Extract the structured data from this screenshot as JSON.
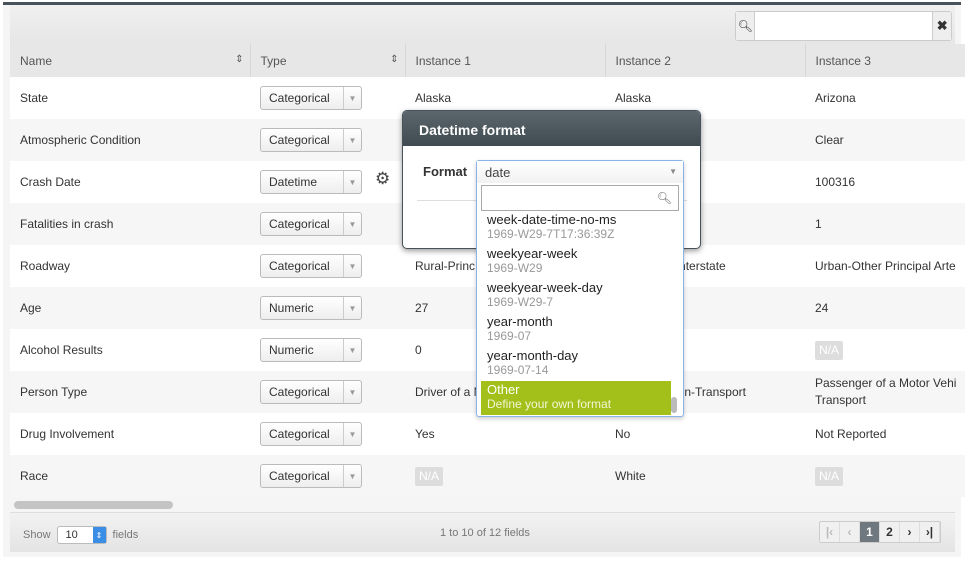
{
  "search": {
    "placeholder": "",
    "search_icon": "search-icon",
    "clear_icon": "x-icon"
  },
  "columns": [
    "Name",
    "Type",
    "Instance 1",
    "Instance 2",
    "Instance 3"
  ],
  "rows": [
    {
      "name": "State",
      "type": "Categorical",
      "i1": "Alaska",
      "i2": "Alaska",
      "i3": "Arizona"
    },
    {
      "name": "Atmospheric Condition",
      "type": "Categorical",
      "i1": "",
      "i2": "",
      "i3": "Clear"
    },
    {
      "name": "Crash Date",
      "type": "Datetime",
      "i1": "",
      "i2": "",
      "i3": "100316"
    },
    {
      "name": "Fatalities in crash",
      "type": "Categorical",
      "i1": "",
      "i2": "",
      "i3": "1"
    },
    {
      "name": "Roadway",
      "type": "Categorical",
      "i1": "Rural-Princ",
      "i2": "pal Arterial-Interstate",
      "i3": "Urban-Other Principal Arte"
    },
    {
      "name": "Age",
      "type": "Numeric",
      "i1": "27",
      "i2": "",
      "i3": "24"
    },
    {
      "name": "Alcohol Results",
      "type": "Numeric",
      "i1": "0",
      "i2": "",
      "i3": "N/A"
    },
    {
      "name": "Person Type",
      "type": "Categorical",
      "i1": "Driver of a M Transport",
      "i2": "otor Vehicle In-Transport",
      "i3": "Passenger of a Motor Vehi Transport"
    },
    {
      "name": "Drug Involvement",
      "type": "Categorical",
      "i1": "Yes",
      "i2": "No",
      "i3": "Not Reported"
    },
    {
      "name": "Race",
      "type": "Categorical",
      "i1": "N/A",
      "i2": "White",
      "i3": "N/A"
    }
  ],
  "footer": {
    "show": "Show",
    "page_size": "10",
    "fields": "fields",
    "info": "1 to 10 of 12 fields",
    "pages": [
      "1",
      "2"
    ],
    "current_page": "1"
  },
  "modal": {
    "title": "Datetime format",
    "format_label": "Format",
    "selected": "date",
    "options": [
      {
        "label": "week-date-time-no-ms",
        "example": "1969-W29-7T17:36:39Z"
      },
      {
        "label": "weekyear-week",
        "example": "1969-W29"
      },
      {
        "label": "weekyear-week-day",
        "example": "1969-W29-7"
      },
      {
        "label": "year-month",
        "example": "1969-07"
      },
      {
        "label": "year-month-day",
        "example": "1969-07-14"
      },
      {
        "label": "Other",
        "example": "Define your own format",
        "highlighted": true
      }
    ]
  },
  "colors": {
    "highlight": "#a3bf19",
    "header_dark": "#47525a",
    "accent_blue": "#3a8ee6"
  }
}
